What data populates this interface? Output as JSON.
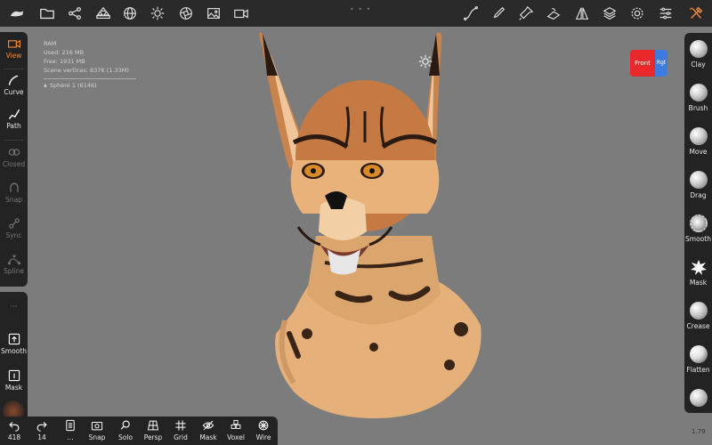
{
  "top_toolbar": {
    "icons": [
      "logo-icon",
      "folder-icon",
      "share-nodes-icon",
      "scene-stack-icon",
      "globe-icon",
      "sun-icon",
      "aperture-icon",
      "image-icon",
      "video-icon",
      "curve-stroke-icon",
      "brush-pen-icon",
      "paint-tube-icon",
      "layers-paint-icon",
      "symmetry-icon",
      "layers-icon",
      "settings-gear-icon",
      "sliders-icon",
      "tools-icon"
    ],
    "accent": "#f08a3c"
  },
  "stats": {
    "ram": "RAM",
    "used": "Used: 216 MB",
    "free": "Free: 1931 MB",
    "vertices": "Scene vertices: 837K (1.33M)",
    "scene_item": "Sphere 1 (6146)"
  },
  "left_toolbar": {
    "items": [
      {
        "label": "View",
        "state": "active"
      },
      {
        "label": "Curve",
        "state": "normal"
      },
      {
        "label": "Path",
        "state": "normal"
      },
      {
        "label": "Closed",
        "state": "dim"
      },
      {
        "label": "Snap",
        "state": "dim"
      },
      {
        "label": "Sync",
        "state": "dim"
      },
      {
        "label": "Spline",
        "state": "dim"
      }
    ],
    "lower_items": [
      {
        "label": "Smooth"
      },
      {
        "label": "Mask"
      }
    ],
    "lower_dots": "···"
  },
  "right_toolbar": {
    "tools": [
      "Clay",
      "Brush",
      "Move",
      "Drag",
      "Smooth",
      "Mask",
      "Crease",
      "Flatten"
    ]
  },
  "bottom_toolbar": {
    "undo_count": "418",
    "redo_count": "14",
    "buttons": [
      "...",
      "Snap",
      "Solo",
      "Persp",
      "Grid",
      "Mask",
      "Voxel",
      "Wire"
    ]
  },
  "view_cube": {
    "front": "Front",
    "right": "Rgt",
    "front_color": "#e8282a",
    "right_color": "#3d7be0"
  },
  "version": "1.79"
}
